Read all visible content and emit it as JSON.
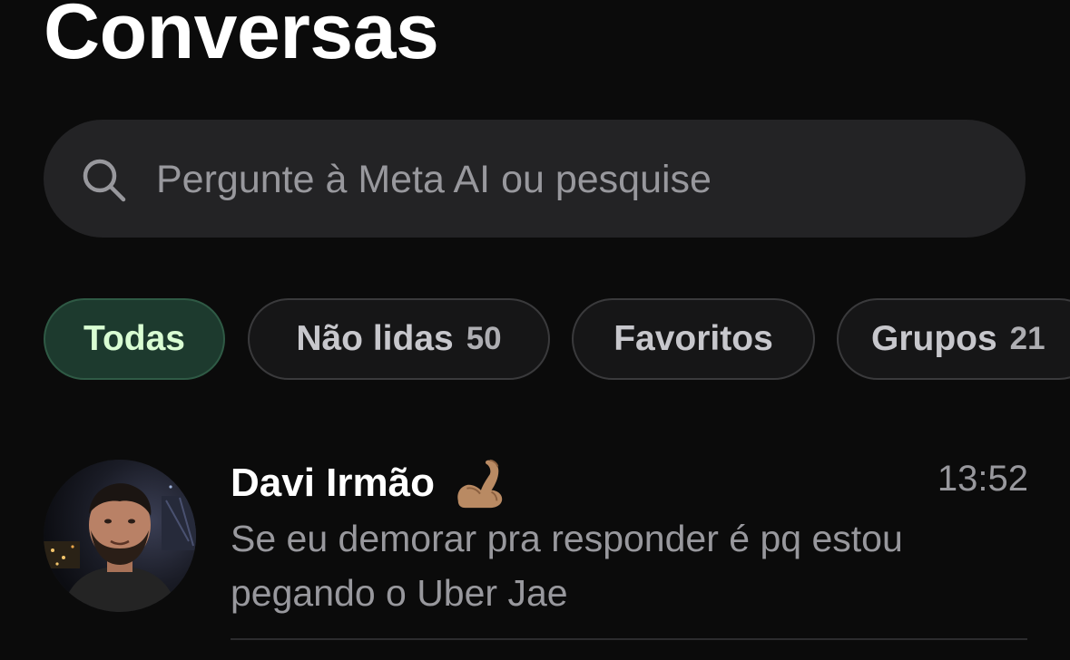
{
  "header": {
    "title": "Conversas"
  },
  "search": {
    "placeholder": "Pergunte à Meta AI ou pesquise",
    "icon": "search-icon"
  },
  "filters": [
    {
      "label": "Todas",
      "count": "",
      "active": true
    },
    {
      "label": "Não lidas",
      "count": "50",
      "active": false
    },
    {
      "label": "Favoritos",
      "count": "",
      "active": false
    },
    {
      "label": "Grupos",
      "count": "21",
      "active": false
    }
  ],
  "chats": [
    {
      "name": "Davi Irmão",
      "emoji_icon": "flexed-biceps-icon",
      "time": "13:52",
      "preview": "Se eu demorar pra responder é pq estou pegando o Uber Jae"
    }
  ],
  "colors": {
    "background": "#0b0b0b",
    "search_bg": "#232325",
    "chip_active_bg": "#1d3a2e",
    "chip_active_text": "#d9fdd3",
    "secondary_text": "#98989d"
  }
}
